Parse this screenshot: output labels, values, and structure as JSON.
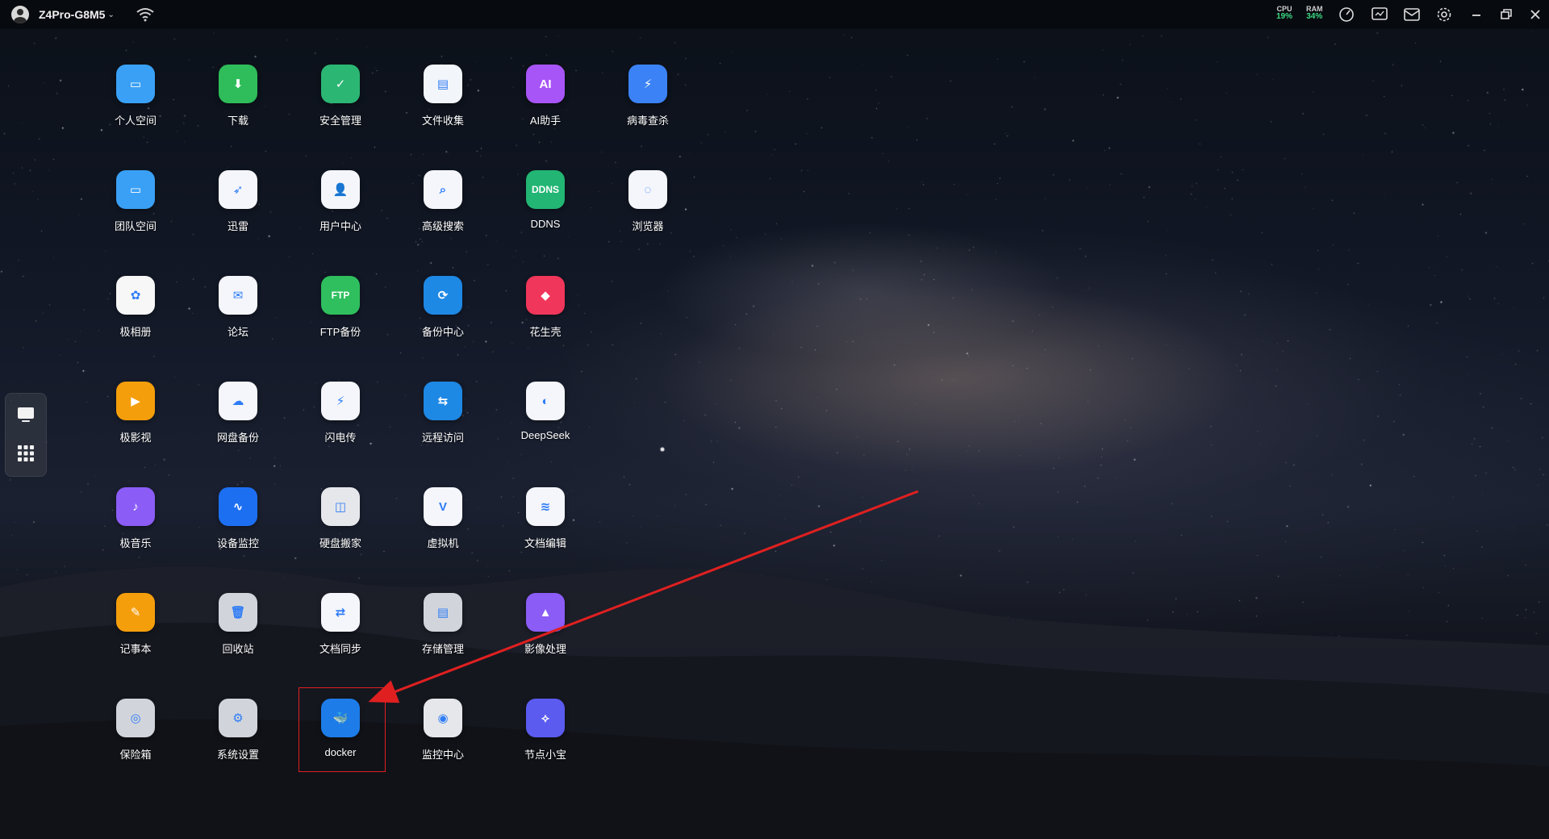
{
  "topbar": {
    "device_name": "Z4Pro-G8M5",
    "device_chevron": "⌄",
    "cpu": {
      "label": "CPU",
      "value": "19%"
    },
    "ram": {
      "label": "RAM",
      "value": "34%"
    },
    "icons": [
      "speedometer-icon",
      "monitor-icon",
      "mail-icon",
      "gear-icon",
      "minimize-icon",
      "restore-icon",
      "close-icon"
    ]
  },
  "dock": {
    "items": [
      "desktop-icon",
      "grid-icon"
    ]
  },
  "apps": [
    {
      "label": "个人空间",
      "color": "#3aa0f5"
    },
    {
      "label": "下载",
      "color": "#2ebd5a"
    },
    {
      "label": "安全管理",
      "color": "#2bb673"
    },
    {
      "label": "文件收集",
      "color": "#f2f5fa"
    },
    {
      "label": "AI助手",
      "color": "#a855f7"
    },
    {
      "label": "病毒查杀",
      "color": "#3b82f6"
    },
    {
      "label": "团队空间",
      "color": "#3aa0f5"
    },
    {
      "label": "迅雷",
      "color": "#f4f6fb"
    },
    {
      "label": "用户中心",
      "color": "#f4f6fb"
    },
    {
      "label": "高级搜索",
      "color": "#f4f6fb"
    },
    {
      "label": "DDNS",
      "color": "#22b573"
    },
    {
      "label": "浏览器",
      "color": "#f4f6fb"
    },
    {
      "label": "极相册",
      "color": "#f7f7f7"
    },
    {
      "label": "论坛",
      "color": "#f4f6fb"
    },
    {
      "label": "FTP备份",
      "color": "#2fbf5e"
    },
    {
      "label": "备份中心",
      "color": "#1e88e5"
    },
    {
      "label": "花生壳",
      "color": "#f0365a"
    },
    {
      "label": "极影视",
      "color": "#f59e0b"
    },
    {
      "label": "网盘备份",
      "color": "#f4f6fb"
    },
    {
      "label": "闪电传",
      "color": "#f4f6fb"
    },
    {
      "label": "远程访问",
      "color": "#1e88e5"
    },
    {
      "label": "DeepSeek",
      "color": "#f4f6fb"
    },
    {
      "label": "极音乐",
      "color": "#8b5cf6"
    },
    {
      "label": "设备监控",
      "color": "#1d6ff2"
    },
    {
      "label": "硬盘搬家",
      "color": "#e5e7eb"
    },
    {
      "label": "虚拟机",
      "color": "#f4f6fb"
    },
    {
      "label": "文档编辑",
      "color": "#f4f6fb"
    },
    {
      "label": "记事本",
      "color": "#f59e0b"
    },
    {
      "label": "回收站",
      "color": "#d1d5db"
    },
    {
      "label": "文档同步",
      "color": "#f4f6fb"
    },
    {
      "label": "存储管理",
      "color": "#d1d5db"
    },
    {
      "label": "影像处理",
      "color": "#8b5cf6"
    },
    {
      "label": "保险箱",
      "color": "#d1d5db"
    },
    {
      "label": "系统设置",
      "color": "#d1d5db"
    },
    {
      "label": "docker",
      "color": "#1d7ce8"
    },
    {
      "label": "监控中心",
      "color": "#e5e7eb"
    },
    {
      "label": "节点小宝",
      "color": "#5b5bf0"
    }
  ],
  "annotation": {
    "highlight_color": "#e02020"
  }
}
